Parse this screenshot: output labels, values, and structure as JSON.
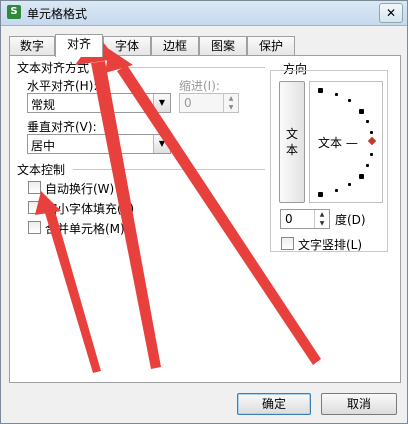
{
  "window": {
    "title": "单元格格式",
    "app_icon": "S",
    "close_glyph": "✕"
  },
  "tabs": [
    {
      "label": "数字"
    },
    {
      "label": "对齐",
      "active": true
    },
    {
      "label": "字体"
    },
    {
      "label": "边框"
    },
    {
      "label": "图案"
    },
    {
      "label": "保护"
    }
  ],
  "alignment": {
    "group_title": "文本对齐方式",
    "horizontal_label": "水平对齐(H):",
    "horizontal_value": "常规",
    "indent_label": "缩进(I):",
    "indent_value": "0",
    "vertical_label": "垂直对齐(V):",
    "vertical_value": "居中"
  },
  "text_control": {
    "group_title": "文本控制",
    "wrap": {
      "label": "自动换行(W)",
      "checked": false
    },
    "shrink": {
      "label": "缩小字体填充(K)",
      "checked": false
    },
    "merge": {
      "label": "合并单元格(M)",
      "checked": false
    }
  },
  "orientation": {
    "group_title": "方向",
    "vertical_text": "文本",
    "dial_text": "文本 —",
    "degrees_value": "0",
    "degrees_label": "度(D)",
    "vertical_checkbox": {
      "label": "文字竖排(L)",
      "checked": false
    }
  },
  "buttons": {
    "ok": "确定",
    "cancel": "取消"
  },
  "colors": {
    "annotation_arrow": "#e8403c",
    "dial_pointer": "#c0392b"
  }
}
